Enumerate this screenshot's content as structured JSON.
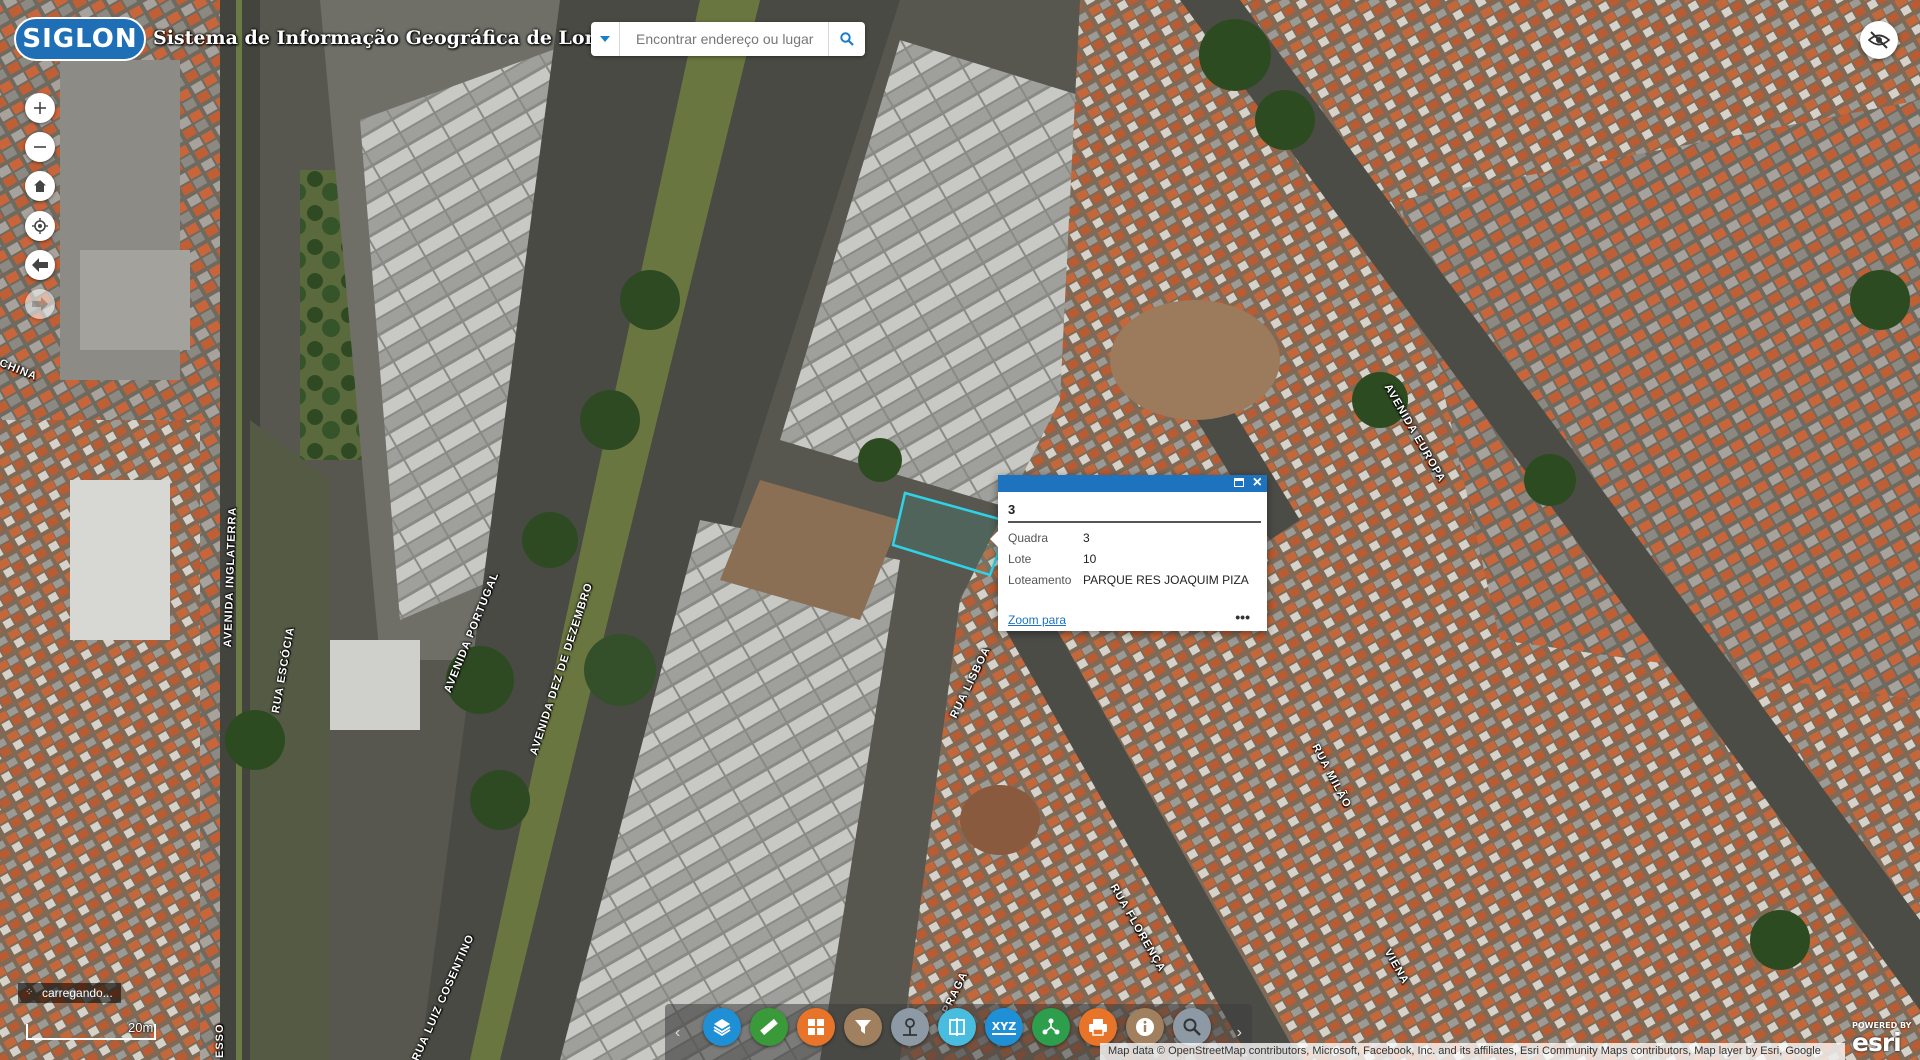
{
  "header": {
    "logo_text": "SIGLON",
    "title": "Sistema de Informação Geográfica de Londrina"
  },
  "search": {
    "placeholder": "Encontrar endereço ou lugar",
    "source_icon": "chevron-down-icon",
    "button_icon": "search-icon"
  },
  "nav_controls": [
    {
      "name": "zoom-in-button",
      "icon": "plus-icon"
    },
    {
      "name": "zoom-out-button",
      "icon": "minus-icon"
    },
    {
      "name": "home-button",
      "icon": "home-icon"
    },
    {
      "name": "locate-button",
      "icon": "locate-icon"
    },
    {
      "name": "previous-extent-button",
      "icon": "arrow-left-icon"
    },
    {
      "name": "next-extent-button",
      "icon": "arrow-right-icon",
      "disabled": true
    }
  ],
  "top_right": {
    "icon": "eye-slash-icon"
  },
  "popup": {
    "title": "3",
    "fields": [
      {
        "label": "Quadra",
        "value": "3"
      },
      {
        "label": "Lote",
        "value": "10"
      },
      {
        "label": "Loteamento",
        "value": "PARQUE RES JOAQUIM PIZA"
      }
    ],
    "zoom_link": "Zoom para",
    "more_icon": "ellipsis-icon"
  },
  "toolbar": {
    "buttons": [
      {
        "name": "layers-button",
        "icon": "layers-icon",
        "color": "#1f8fd6"
      },
      {
        "name": "measure-button",
        "icon": "ruler-icon",
        "color": "#3a9a3a"
      },
      {
        "name": "basemap-gallery-button",
        "icon": "grid-icon",
        "color": "#e8742a"
      },
      {
        "name": "filter-button",
        "icon": "filter-icon",
        "color": "#a0805e"
      },
      {
        "name": "directions-button",
        "icon": "directions-icon",
        "color": "#8d9aa5"
      },
      {
        "name": "swipe-button",
        "icon": "swipe-icon",
        "color": "#48bde0"
      },
      {
        "name": "coordinates-button",
        "icon": "xyz-icon",
        "color": "#1f8fd6"
      },
      {
        "name": "share-button",
        "icon": "share-icon",
        "color": "#2d9e4b"
      },
      {
        "name": "print-button",
        "icon": "print-icon",
        "color": "#e8742a"
      },
      {
        "name": "about-button",
        "icon": "info-icon",
        "color": "#a0805e"
      },
      {
        "name": "query-button",
        "icon": "search-icon",
        "color": "#8d9aa5"
      }
    ]
  },
  "status": {
    "loading_text": "carregando...",
    "scale_label": "20m"
  },
  "attribution": "Map data © OpenStreetMap contributors, Microsoft, Facebook, Inc. and its affiliates, Esri Community Maps contributors, Map layer by Esri, Google",
  "esri": {
    "powered_by": "POWERED BY",
    "name": "esri"
  },
  "streets": [
    {
      "name": "CHINA"
    },
    {
      "name": "AVENIDA INGLATERRA"
    },
    {
      "name": "RUA ESCÓCIA"
    },
    {
      "name": "AVENIDA PORTUGAL"
    },
    {
      "name": "AVENIDA DEZ DE DEZEMBRO"
    },
    {
      "name": "RUA LUIZ COSENTINO"
    },
    {
      "name": "RUA LISBOA"
    },
    {
      "name": "RUA FLORENÇA"
    },
    {
      "name": "RUA MILÃO"
    },
    {
      "name": "AVENIDA EUROPA"
    },
    {
      "name": "VIENA"
    },
    {
      "name": "PRAGA"
    },
    {
      "name": "ESSO"
    }
  ]
}
